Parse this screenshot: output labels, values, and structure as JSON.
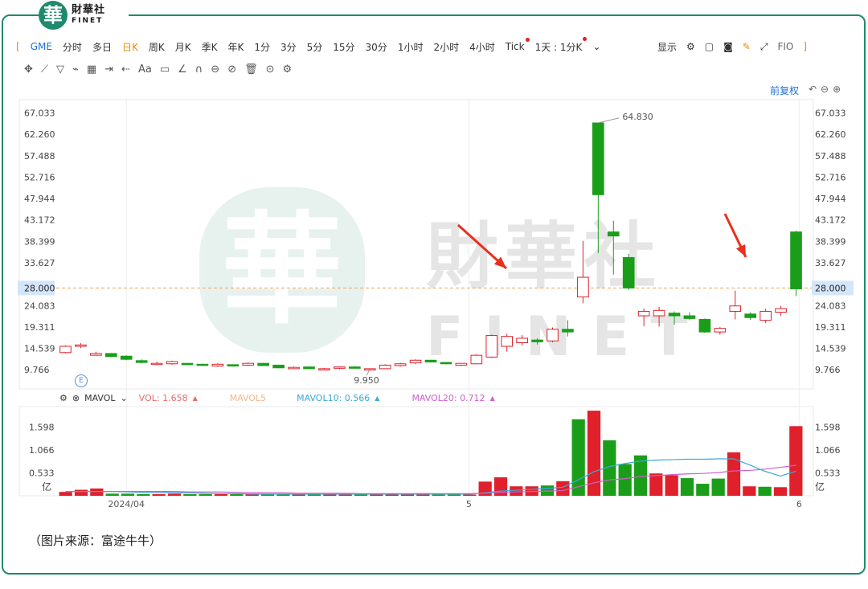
{
  "brand": {
    "seal_char": "華",
    "name_cn": "財華社",
    "name_en": "FINET"
  },
  "toolbar": {
    "left_bracket": "[",
    "symbol": "GME",
    "periods": [
      "分时",
      "多日",
      "日K",
      "周K",
      "月K",
      "季K",
      "年K",
      "1分",
      "3分",
      "5分",
      "15分",
      "30分",
      "1小时",
      "2小时",
      "4小时"
    ],
    "active_period": "日K",
    "tick": "Tick",
    "tick_one": "1天 : 1分K",
    "chevron": "⌄",
    "display": "显示",
    "fio": "FIO",
    "right_bracket": "]"
  },
  "drawing_tools": [
    "✥",
    "⟋",
    "▽",
    "⌁",
    "▦",
    "⇥",
    "⇠",
    "Aa",
    "▭",
    "∠",
    "∩",
    "⊖",
    "⊘",
    "🗑",
    "⊙",
    "⚙"
  ],
  "adjust": {
    "label": "前复权",
    "icons": "↶⊖⊕"
  },
  "indicator_bar": {
    "gear": "⚙",
    "close": "⊗",
    "name": "MAVOL",
    "chevron": "⌄",
    "vol": "VOL: 1.658",
    "mavol5": "MAVOL5",
    "mavol10": "MAVOL10: 0.566",
    "mavol20": "MAVOL20: 0.712",
    "up_mark": "▲"
  },
  "badge": "E",
  "watermark": {
    "seal": "華",
    "cn": "財華社",
    "en": "FINET"
  },
  "source": "（图片来源：富途牛牛）",
  "colors": {
    "up": "#e0202a",
    "down": "#1a9e1a",
    "accent": "#1f8a6e",
    "highlight": "#f08a00",
    "price_line": "#f0a35a"
  },
  "chart_data": {
    "type": "candlestick",
    "price_axis": {
      "ticks": [
        67.033,
        62.26,
        57.488,
        52.716,
        47.944,
        43.172,
        38.399,
        33.627,
        28.0,
        24.083,
        19.311,
        14.539,
        9.766
      ],
      "ylim": [
        5.5,
        70
      ]
    },
    "current_price": 28.0,
    "annotations": {
      "high": 64.83,
      "low": 9.95
    },
    "candles": [
      {
        "o": 13.6,
        "h": 15.2,
        "l": 13.4,
        "c": 15.0
      },
      {
        "o": 15.0,
        "h": 15.7,
        "l": 14.6,
        "c": 15.3
      },
      {
        "o": 13.0,
        "h": 13.8,
        "l": 12.8,
        "c": 13.4
      },
      {
        "o": 13.4,
        "h": 13.5,
        "l": 12.6,
        "c": 12.7
      },
      {
        "o": 12.8,
        "h": 13.0,
        "l": 11.9,
        "c": 12.1
      },
      {
        "o": 11.8,
        "h": 12.1,
        "l": 11.2,
        "c": 11.4
      },
      {
        "o": 11.0,
        "h": 11.6,
        "l": 10.8,
        "c": 11.2
      },
      {
        "o": 11.1,
        "h": 11.8,
        "l": 10.9,
        "c": 11.6
      },
      {
        "o": 11.2,
        "h": 11.3,
        "l": 10.8,
        "c": 10.9
      },
      {
        "o": 11.0,
        "h": 11.1,
        "l": 10.7,
        "c": 10.8
      },
      {
        "o": 10.6,
        "h": 11.2,
        "l": 10.4,
        "c": 11.0
      },
      {
        "o": 10.9,
        "h": 11.0,
        "l": 10.5,
        "c": 10.6
      },
      {
        "o": 10.8,
        "h": 11.4,
        "l": 10.6,
        "c": 11.2
      },
      {
        "o": 11.2,
        "h": 11.3,
        "l": 10.6,
        "c": 10.7
      },
      {
        "o": 10.8,
        "h": 10.9,
        "l": 10.1,
        "c": 10.2
      },
      {
        "o": 10.0,
        "h": 10.5,
        "l": 9.9,
        "c": 10.3
      },
      {
        "o": 10.4,
        "h": 10.5,
        "l": 9.9,
        "c": 10.0
      },
      {
        "o": 10.0,
        "h": 10.2,
        "l": 9.95,
        "c": 10.0
      },
      {
        "o": 10.1,
        "h": 10.5,
        "l": 9.9,
        "c": 10.4
      },
      {
        "o": 10.4,
        "h": 10.6,
        "l": 10.0,
        "c": 10.1
      },
      {
        "o": 9.8,
        "h": 10.1,
        "l": 9.6,
        "c": 10.0
      },
      {
        "o": 10.0,
        "h": 11.0,
        "l": 9.9,
        "c": 10.8
      },
      {
        "o": 10.7,
        "h": 11.3,
        "l": 10.5,
        "c": 11.1
      },
      {
        "o": 11.3,
        "h": 12.1,
        "l": 11.0,
        "c": 11.9
      },
      {
        "o": 11.9,
        "h": 12.0,
        "l": 11.4,
        "c": 11.5
      },
      {
        "o": 11.4,
        "h": 11.5,
        "l": 11.0,
        "c": 11.1
      },
      {
        "o": 10.8,
        "h": 11.3,
        "l": 10.6,
        "c": 11.2
      },
      {
        "o": 11.1,
        "h": 13.2,
        "l": 11.0,
        "c": 13.0
      },
      {
        "o": 12.6,
        "h": 17.6,
        "l": 12.4,
        "c": 17.4
      },
      {
        "o": 15.0,
        "h": 17.8,
        "l": 13.8,
        "c": 17.2
      },
      {
        "o": 15.8,
        "h": 17.5,
        "l": 15.2,
        "c": 16.8
      },
      {
        "o": 16.4,
        "h": 16.8,
        "l": 15.4,
        "c": 16.0
      },
      {
        "o": 16.2,
        "h": 19.2,
        "l": 15.9,
        "c": 18.8
      },
      {
        "o": 18.8,
        "h": 20.8,
        "l": 17.2,
        "c": 18.2
      },
      {
        "o": 26.0,
        "h": 38.5,
        "l": 24.6,
        "c": 30.4
      },
      {
        "o": 64.8,
        "h": 64.8,
        "l": 35.8,
        "c": 48.8
      },
      {
        "o": 40.5,
        "h": 43.0,
        "l": 31.0,
        "c": 39.6
      },
      {
        "o": 34.8,
        "h": 35.6,
        "l": 27.6,
        "c": 28.0
      },
      {
        "o": 21.8,
        "h": 23.4,
        "l": 19.5,
        "c": 22.8
      },
      {
        "o": 21.8,
        "h": 23.8,
        "l": 19.4,
        "c": 23.0
      },
      {
        "o": 22.4,
        "h": 22.8,
        "l": 19.8,
        "c": 21.8
      },
      {
        "o": 21.8,
        "h": 22.6,
        "l": 20.8,
        "c": 21.2
      },
      {
        "o": 21.0,
        "h": 21.2,
        "l": 18.0,
        "c": 18.2
      },
      {
        "o": 18.2,
        "h": 19.3,
        "l": 17.6,
        "c": 19.0
      },
      {
        "o": 22.8,
        "h": 27.4,
        "l": 21.0,
        "c": 24.0
      },
      {
        "o": 22.2,
        "h": 22.6,
        "l": 20.9,
        "c": 21.4
      },
      {
        "o": 20.8,
        "h": 23.4,
        "l": 20.2,
        "c": 22.8
      },
      {
        "o": 22.6,
        "h": 24.0,
        "l": 21.8,
        "c": 23.4
      },
      {
        "o": 40.5,
        "h": 40.8,
        "l": 26.2,
        "c": 27.8
      }
    ],
    "volume": {
      "axis_ticks": [
        1.598,
        1.066,
        0.533
      ],
      "unit": "亿",
      "ylim": [
        0,
        2.0
      ],
      "values": [
        0.09,
        0.14,
        0.17,
        0.05,
        0.05,
        0.04,
        0.04,
        0.05,
        0.04,
        0.04,
        0.04,
        0.04,
        0.04,
        0.04,
        0.04,
        0.03,
        0.03,
        0.03,
        0.03,
        0.03,
        0.03,
        0.04,
        0.04,
        0.06,
        0.03,
        0.03,
        0.03,
        0.33,
        0.43,
        0.22,
        0.22,
        0.24,
        0.34,
        1.78,
        1.98,
        1.29,
        0.74,
        0.94,
        0.52,
        0.48,
        0.41,
        0.28,
        0.4,
        1.01,
        0.22,
        0.21,
        0.2,
        1.62
      ],
      "mavol10": [
        0.1,
        0.1,
        0.1,
        0.1,
        0.09,
        0.08,
        0.08,
        0.07,
        0.07,
        0.06,
        0.05,
        0.05,
        0.04,
        0.04,
        0.04,
        0.04,
        0.04,
        0.04,
        0.04,
        0.04,
        0.04,
        0.04,
        0.04,
        0.04,
        0.04,
        0.04,
        0.04,
        0.07,
        0.11,
        0.13,
        0.15,
        0.17,
        0.2,
        0.37,
        0.56,
        0.68,
        0.75,
        0.81,
        0.83,
        0.84,
        0.85,
        0.85,
        0.86,
        0.86,
        0.72,
        0.57,
        0.46,
        0.57
      ],
      "mavol20": [
        0.1,
        0.1,
        0.1,
        0.1,
        0.1,
        0.1,
        0.1,
        0.1,
        0.09,
        0.09,
        0.09,
        0.08,
        0.07,
        0.07,
        0.07,
        0.06,
        0.06,
        0.06,
        0.06,
        0.05,
        0.05,
        0.05,
        0.05,
        0.05,
        0.05,
        0.05,
        0.05,
        0.06,
        0.08,
        0.09,
        0.1,
        0.11,
        0.12,
        0.21,
        0.3,
        0.37,
        0.4,
        0.45,
        0.47,
        0.49,
        0.51,
        0.52,
        0.54,
        0.58,
        0.59,
        0.62,
        0.66,
        0.71
      ]
    },
    "x_labels": [
      {
        "index": 4,
        "label": "2024/04"
      },
      {
        "index": 26.5,
        "label": "5"
      },
      {
        "index": 48.2,
        "label": "6"
      }
    ]
  }
}
